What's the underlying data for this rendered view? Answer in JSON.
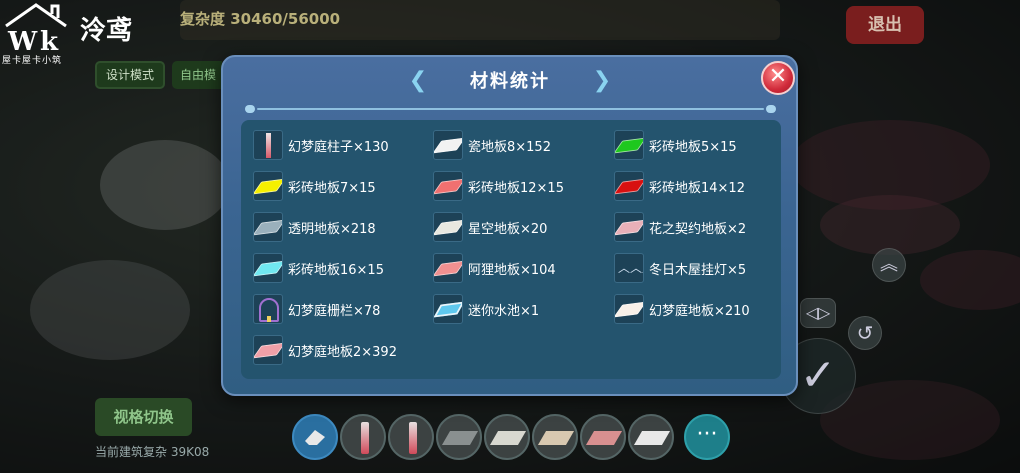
{
  "watermark": {
    "logo_text": "W",
    "name": "泠鸢",
    "subtitle": "屋卡屋卡小筑"
  },
  "hud": {
    "complexity": "复杂度 30460/56000",
    "exit_label": "退出",
    "design_mode_label": "设计模式",
    "free_label": "自由模",
    "view_switch_label": "视格切换",
    "bottom_text": "当前建筑复杂 39K08"
  },
  "hotbar": {
    "items": [
      {
        "icon": "eraser-icon",
        "color": "#2a6fa0"
      },
      {
        "icon": "pillar-icon",
        "color": "#d04a5a"
      },
      {
        "icon": "pillar-icon",
        "color": "#d04a5a"
      },
      {
        "icon": "tile-icon",
        "color": "#8a9090"
      },
      {
        "icon": "tile-icon",
        "color": "#d8d8d0"
      },
      {
        "icon": "tile-icon",
        "color": "#d8c8b0"
      },
      {
        "icon": "tile-icon",
        "color": "#d89090"
      },
      {
        "icon": "tile-icon",
        "color": "#e8e8e8"
      }
    ],
    "more_label": "···"
  },
  "modal": {
    "title": "材料统计",
    "close_label": "✕",
    "items": [
      {
        "label": "幻梦庭柱子×130",
        "icon": "pillar",
        "color": "#d85a6a"
      },
      {
        "label": "瓷地板8×152",
        "icon": "tile",
        "color": "#f2f2f2"
      },
      {
        "label": "彩砖地板5×15",
        "icon": "tile",
        "color": "#1ec81e"
      },
      {
        "label": "彩砖地板7×15",
        "icon": "tile",
        "color": "#f5f000"
      },
      {
        "label": "彩砖地板12×15",
        "icon": "tile",
        "color": "#f07070"
      },
      {
        "label": "彩砖地板14×12",
        "icon": "tile",
        "color": "#d81010"
      },
      {
        "label": "透明地板×218",
        "icon": "tile",
        "color": "#9ab0bc"
      },
      {
        "label": "星空地板×20",
        "icon": "tile",
        "color": "#e8e8e0"
      },
      {
        "label": "花之契约地板×2",
        "icon": "tile",
        "color": "#e8b0b8"
      },
      {
        "label": "彩砖地板16×15",
        "icon": "tile",
        "color": "#70e8f0"
      },
      {
        "label": "阿狸地板×104",
        "icon": "tile",
        "color": "#f09090"
      },
      {
        "label": "冬日木屋挂灯×5",
        "icon": "lamp",
        "color": "#cfe0ee"
      },
      {
        "label": "幻梦庭栅栏×78",
        "icon": "fence",
        "color": "#a070d0"
      },
      {
        "label": "迷你水池×1",
        "icon": "pool",
        "color": "#5fc8ee"
      },
      {
        "label": "幻梦庭地板×210",
        "icon": "tile",
        "color": "#f8f0e8"
      },
      {
        "label": "幻梦庭地板2×392",
        "icon": "tile",
        "color": "#f0a0a8"
      }
    ]
  }
}
